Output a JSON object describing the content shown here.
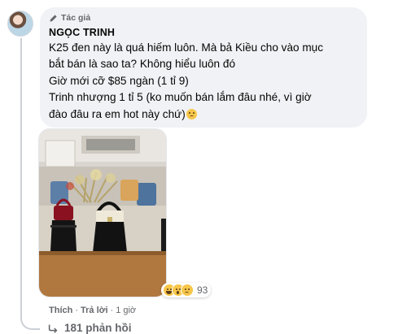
{
  "comment": {
    "author_badge": "Tác giả",
    "author_name": "NGỌC TRINH",
    "lines": [
      "K25 đen này là quá hiếm luôn. Mà bả Kiều cho vào mục",
      "bắt bán là sao ta? Không hiểu luôn đó",
      "Giờ mới cỡ $85 ngàn (1 tỉ 9)",
      "Trinh nhượng 1 tỉ 5 (ko muốn bán lắm đâu nhé, vì giờ",
      "đào đâu ra em hot này chứ)"
    ],
    "emoji": "sad-face-icon"
  },
  "reactions": {
    "count": "93",
    "types": [
      "haha",
      "wow",
      "sad"
    ]
  },
  "actions": {
    "like": "Thích",
    "reply": "Trả lời",
    "time": "1 giờ"
  },
  "replies": {
    "label": "181 phản hồi"
  },
  "colors": {
    "bubble": "#f0f2f5",
    "muted": "#65676b",
    "text": "#050505"
  }
}
